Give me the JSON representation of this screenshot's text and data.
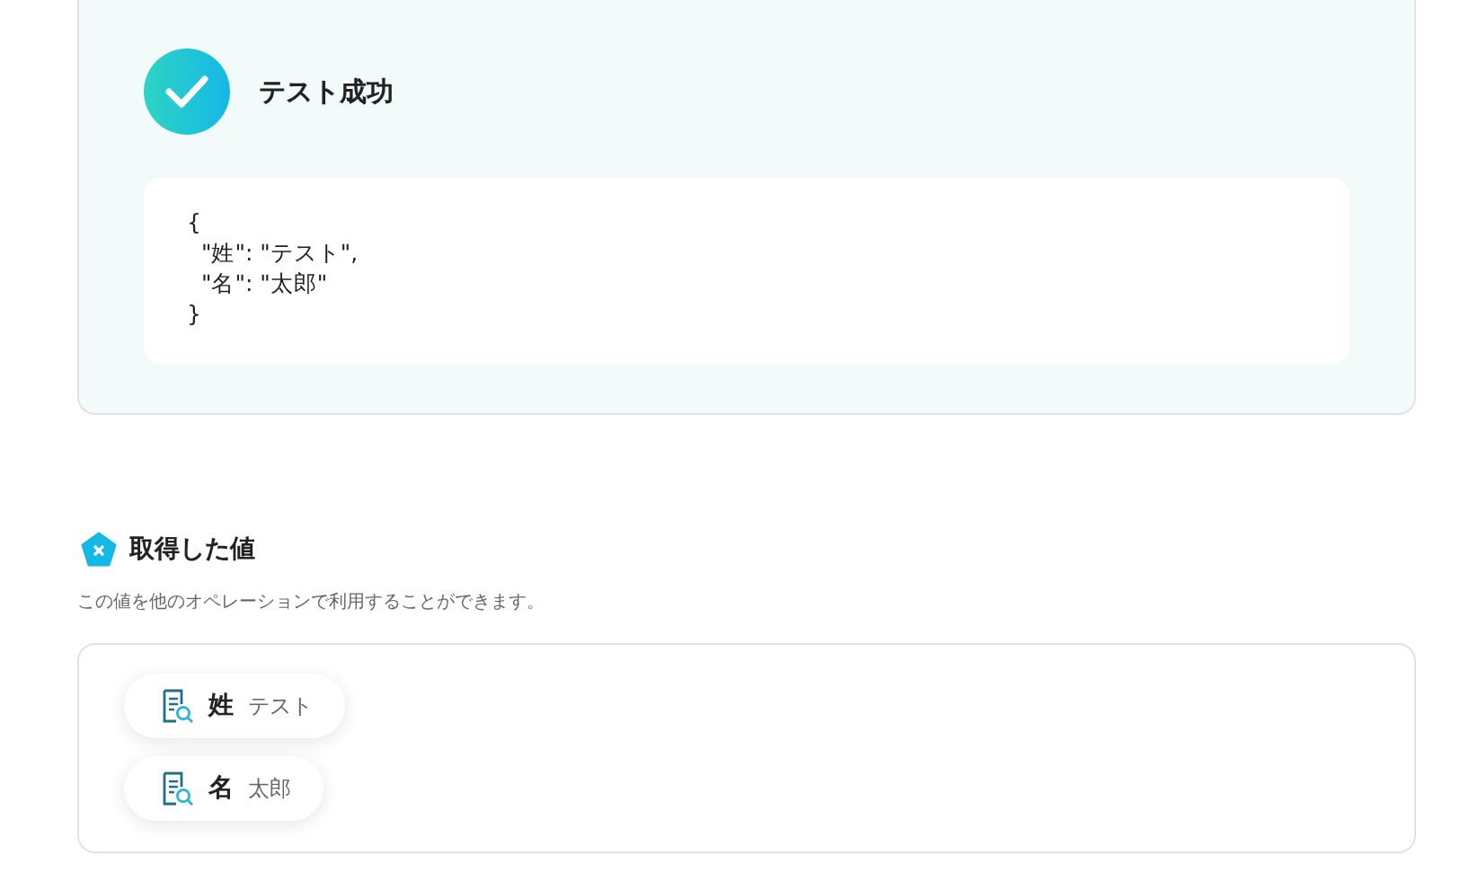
{
  "result": {
    "title": "テスト成功",
    "code_lines": [
      "{",
      "  \"姓\": \"テスト\",",
      "  \"名\": \"太郎\"",
      "}"
    ]
  },
  "values": {
    "title": "取得した値",
    "description": "この値を他のオペレーションで利用することができます。",
    "items": [
      {
        "key": "姓",
        "value": "テスト"
      },
      {
        "key": "名",
        "value": "太郎"
      }
    ]
  }
}
